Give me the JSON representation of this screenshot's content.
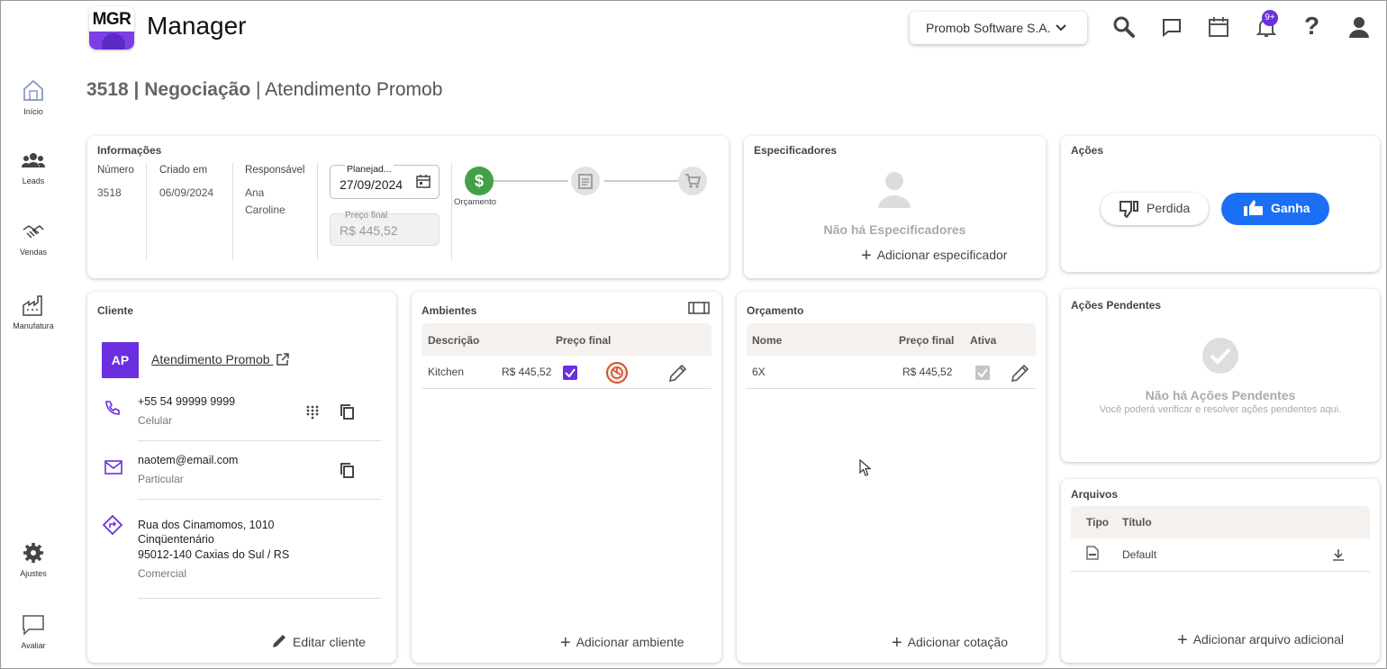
{
  "header": {
    "logo_text": "MGR",
    "app_title": "Manager",
    "company": "Promob Software S.A.",
    "notif_count": "9+"
  },
  "sidebar": {
    "items": [
      {
        "label": "Início",
        "icon": "home-icon"
      },
      {
        "label": "Leads",
        "icon": "people-icon"
      },
      {
        "label": "Vendas",
        "icon": "handshake-icon"
      },
      {
        "label": "Manufatura",
        "icon": "factory-icon"
      },
      {
        "label": "Ajustes",
        "icon": "gear-icon"
      },
      {
        "label": "Avaliar",
        "icon": "chat-icon"
      }
    ]
  },
  "page": {
    "id_type": "3518 | Negociação",
    "separator": " | ",
    "name": "Atendimento Promob"
  },
  "info": {
    "title": "Informações",
    "numero_label": "Número",
    "numero": "3518",
    "criado_label": "Criado em",
    "criado": "06/09/2024",
    "resp_label": "Responsável",
    "resp_line1": "Ana",
    "resp_line2": "Caroline",
    "planejado_label": "Planejad...",
    "planejado": "27/09/2024",
    "preco_label": "Preço final",
    "preco": "R$ 445,52",
    "step1_label": "Orçamento"
  },
  "especificadores": {
    "title": "Especificadores",
    "empty": "Não há Especificadores",
    "add": "Adicionar especificador"
  },
  "acoes": {
    "title": "Ações",
    "lost": "Perdida",
    "won": "Ganha"
  },
  "cliente": {
    "title": "Cliente",
    "initials": "AP",
    "name": "Atendimento Promob",
    "phone": "+55 54 99999 9999",
    "phone_type": "Celular",
    "email": "naotem@email.com",
    "email_type": "Particular",
    "addr1": "Rua dos Cinamomos, 1010",
    "addr2": "Cinqüentenário",
    "addr3": "95012-140 Caxias do Sul / RS",
    "addr_type": "Comercial",
    "edit": "Editar cliente"
  },
  "ambientes": {
    "title": "Ambientes",
    "col_desc": "Descrição",
    "col_price": "Preço final",
    "rows": [
      {
        "desc": "Kitchen",
        "price": "R$ 445,52"
      }
    ],
    "add": "Adicionar ambiente"
  },
  "orcamento": {
    "title": "Orçamento",
    "col_name": "Nome",
    "col_price": "Preço final",
    "col_active": "Ativa",
    "rows": [
      {
        "name": "6X",
        "price": "R$ 445,52"
      }
    ],
    "add": "Adicionar cotação"
  },
  "pendentes": {
    "title": "Ações Pendentes",
    "empty": "Não há Ações Pendentes",
    "sub": "Você poderá verificar e resolver ações pendentes aqui."
  },
  "arquivos": {
    "title": "Arquivos",
    "col_type": "Tipo",
    "col_title": "Título",
    "rows": [
      {
        "title": "Default"
      }
    ],
    "add": "Adicionar arquivo adicional"
  },
  "colors": {
    "accent": "#6a2fe0",
    "won_button": "#1a6ff5",
    "step_done": "#43a047"
  }
}
